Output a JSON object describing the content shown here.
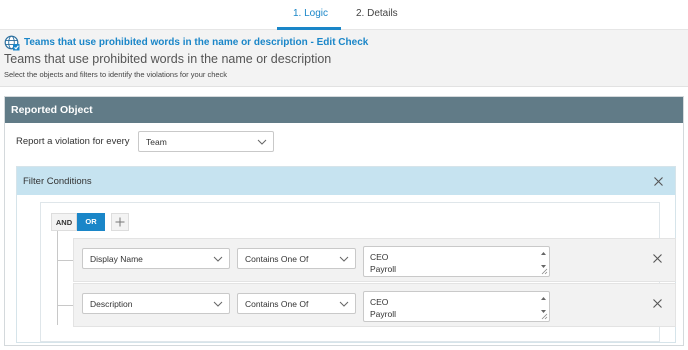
{
  "tabs": [
    {
      "label": "1. Logic",
      "active": true
    },
    {
      "label": "2. Details",
      "active": false
    }
  ],
  "header": {
    "title": "Teams that use prohibited words in the name or description - Edit Check",
    "heading": "Teams that use prohibited words in the name or description",
    "subtitle": "Select the objects and filters to identify the violations for your check"
  },
  "reported_object": {
    "title": "Reported Object",
    "report_label": "Report a violation for every",
    "report_value": "Team"
  },
  "filter_conditions": {
    "title": "Filter Conditions",
    "logic": {
      "and_label": "AND",
      "or_label": "OR",
      "selected": "OR"
    },
    "conditions": [
      {
        "field": "Display Name",
        "operator": "Contains One Of",
        "values": [
          "CEO",
          "Payroll"
        ]
      },
      {
        "field": "Description",
        "operator": "Contains One Of",
        "values": [
          "CEO",
          "Payroll"
        ]
      }
    ]
  },
  "colors": {
    "accent": "#1a86c8",
    "panel_header": "#617b87",
    "filter_header": "#c6e3f0"
  }
}
